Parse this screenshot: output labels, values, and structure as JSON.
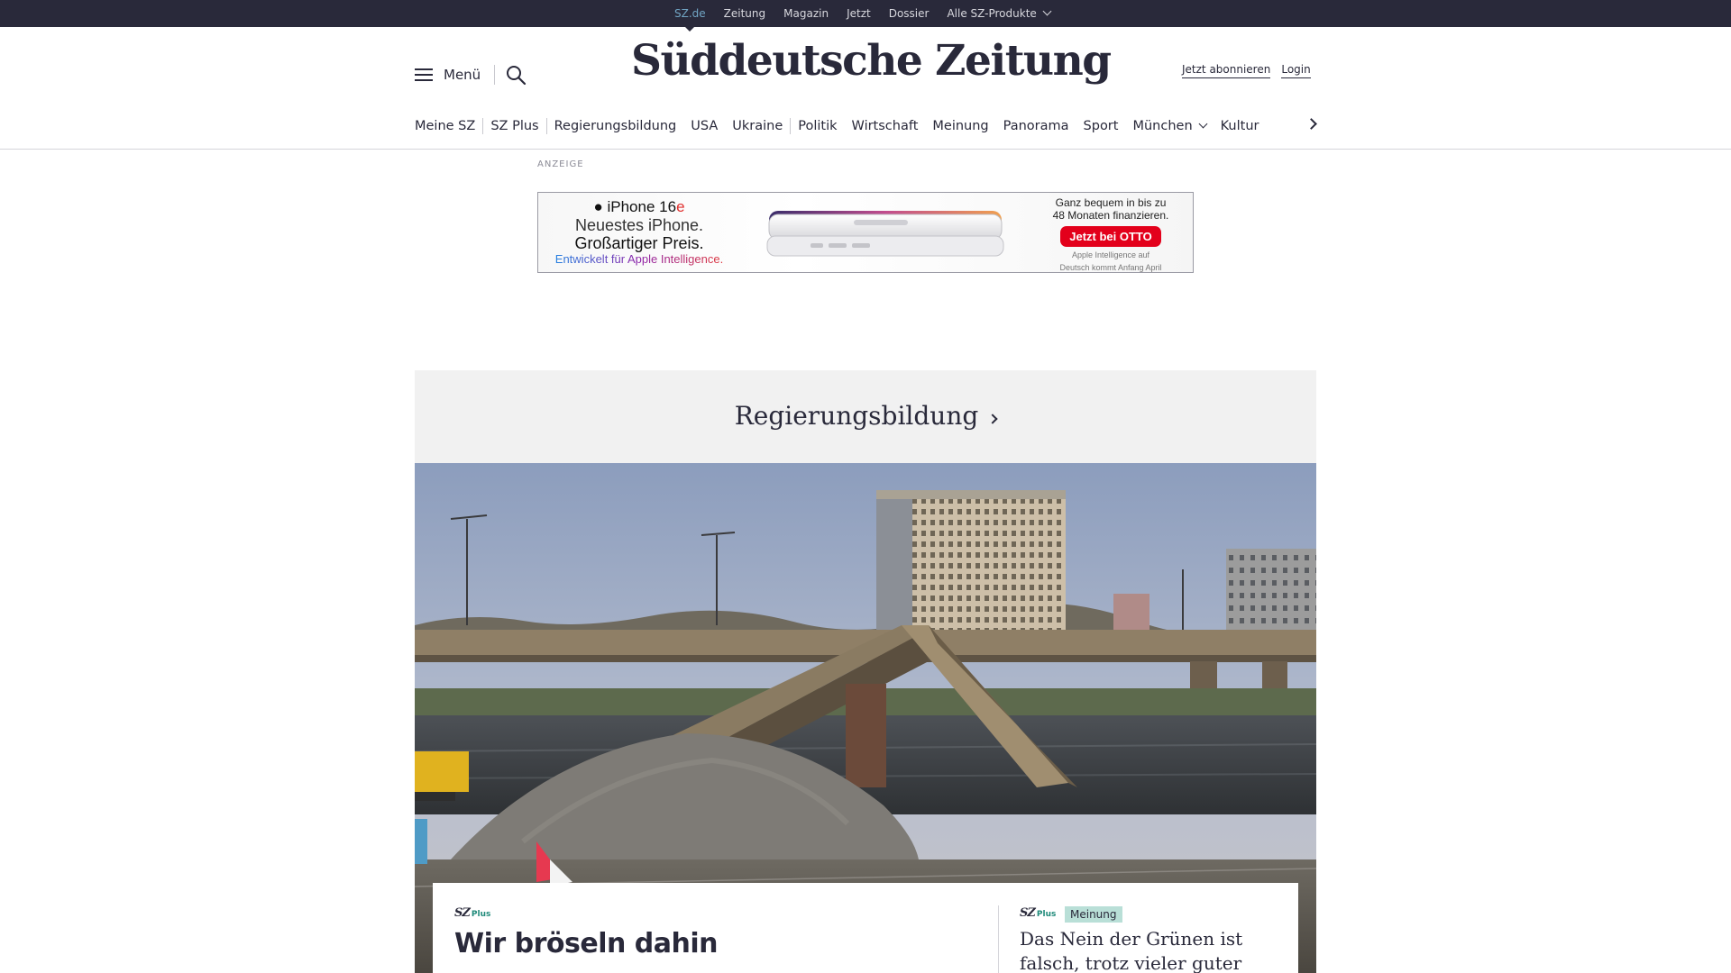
{
  "topbar": {
    "links": [
      {
        "label": "SZ.de"
      },
      {
        "label": "Zeitung"
      },
      {
        "label": "Magazin"
      },
      {
        "label": "Jetzt"
      },
      {
        "label": "Dossier"
      },
      {
        "label": "Alle SZ-Produkte"
      }
    ],
    "active_color": "#71a5c4",
    "background": "#29293a"
  },
  "header": {
    "menu_label": "Menü",
    "logo_text": "Süddeutsche Zeitung",
    "subscribe_label": "Jetzt abonnieren",
    "login_label": "Login"
  },
  "nav": {
    "items": [
      {
        "label": "Meine SZ"
      },
      {
        "label": "SZ Plus"
      },
      {
        "label": "Regierungsbildung"
      },
      {
        "label": "USA"
      },
      {
        "label": "Ukraine"
      },
      {
        "label": "Politik"
      },
      {
        "label": "Wirtschaft"
      },
      {
        "label": "Meinung"
      },
      {
        "label": "Panorama"
      },
      {
        "label": "Sport"
      },
      {
        "label": "München"
      },
      {
        "label": "Kultur"
      }
    ]
  },
  "ad": {
    "label": "ANZEIGE",
    "product": "iPhone 16",
    "product_suffix": "e",
    "line1": "Neuestes iPhone.",
    "line2": "Großartiger Preis.",
    "line3": "Entwickelt für Apple Intelligence.",
    "finance_1": "Ganz bequem in bis zu",
    "finance_2": "48 Monaten finanzieren.",
    "cta": "Jetzt bei OTTO",
    "note_1": "Apple Intelligence auf",
    "note_2": "Deutsch kommt Anfang April"
  },
  "topic": {
    "title": "Regierungsbildung"
  },
  "teasers": {
    "main": {
      "sz": "SZ",
      "plus": "Plus",
      "headline": "Wir bröseln dahin"
    },
    "side": {
      "sz": "SZ",
      "plus": "Plus",
      "badge": "Meinung",
      "headline": "Das Nein der Grünen ist falsch, trotz vieler guter"
    }
  },
  "colors": {
    "text": "#29293a",
    "ad_cta": "#e3001b",
    "badge_bg": "#b9dfd7",
    "plus_green": "#1f8a7a"
  }
}
